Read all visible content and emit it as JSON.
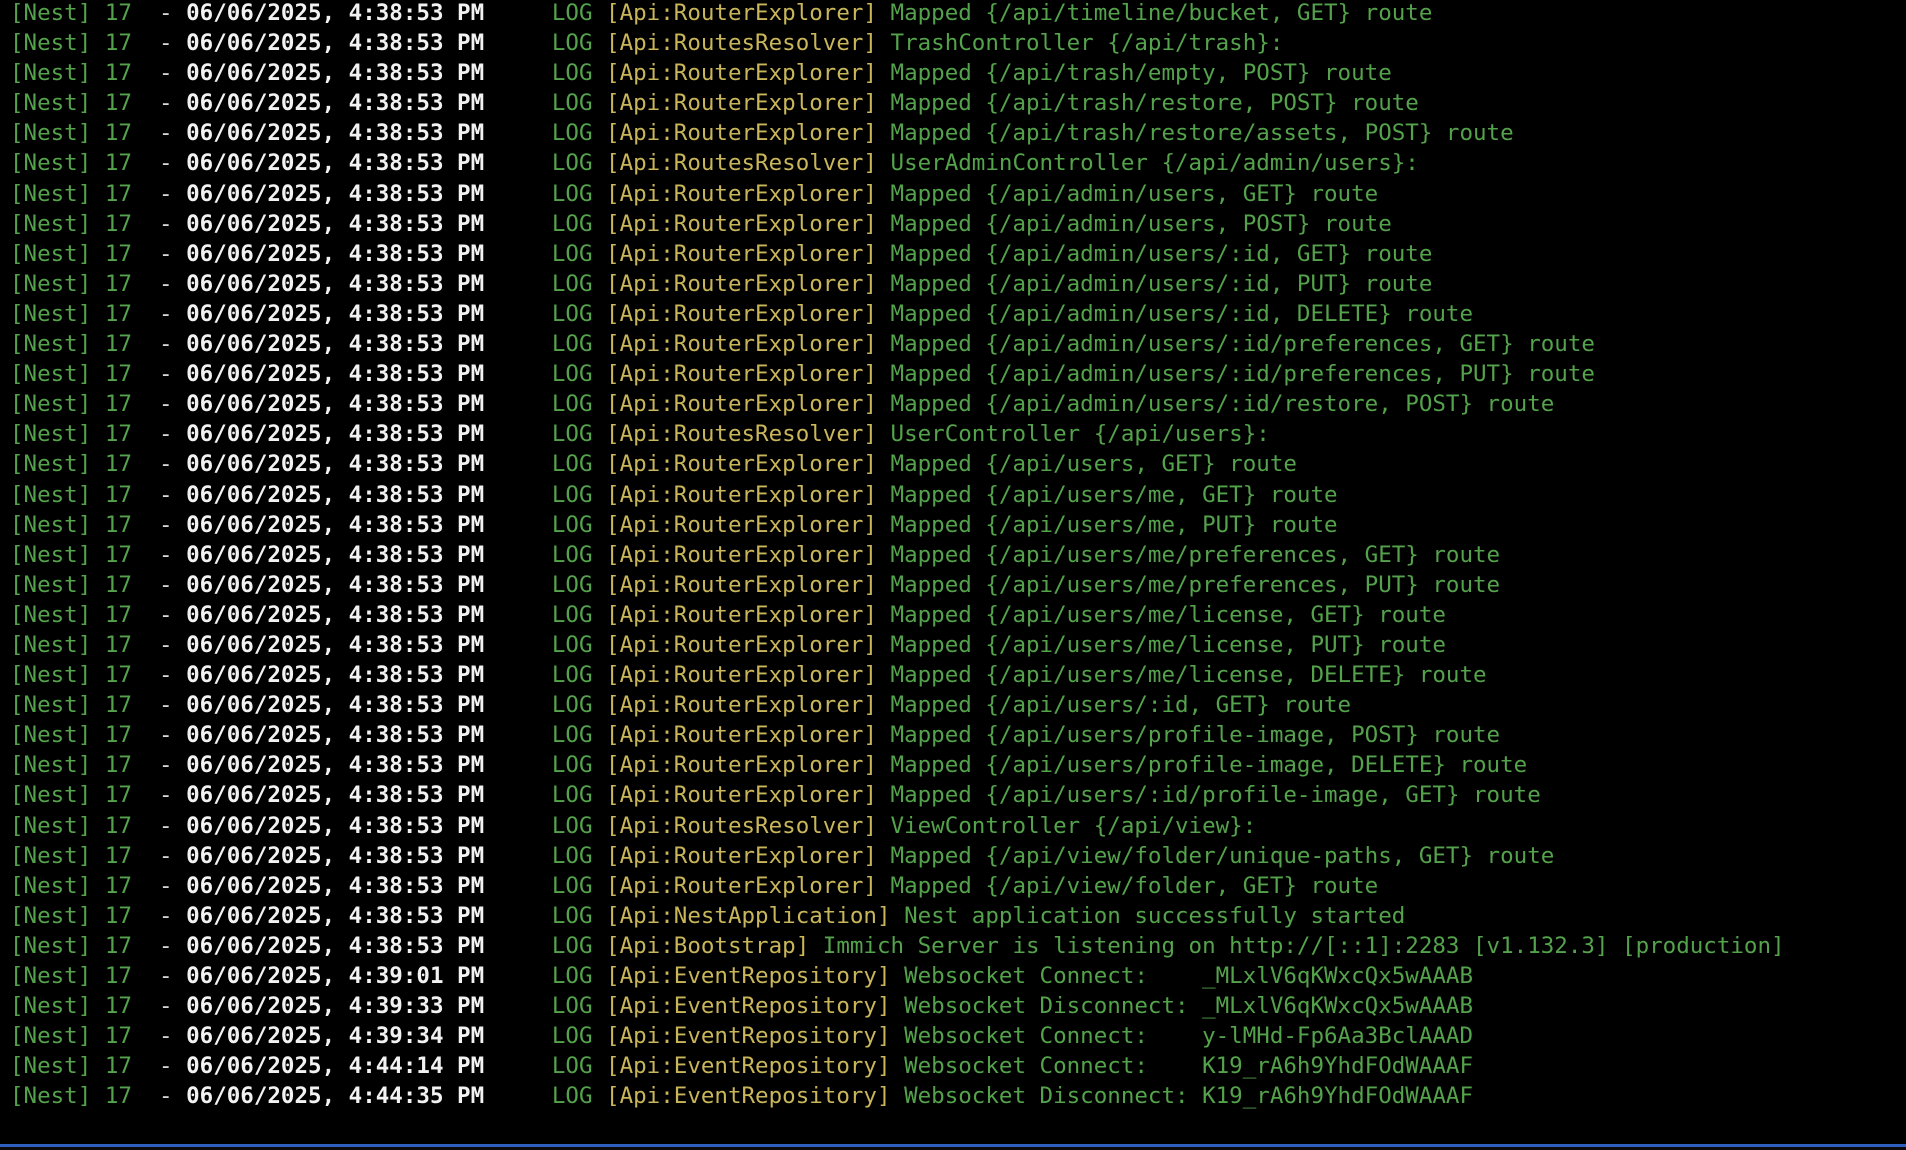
{
  "terminal": {
    "colors": {
      "background": "#000000",
      "prefix": "#54a24b",
      "timestamp": "#f2f2f2",
      "context": "#c9b65a",
      "message": "#54a24b",
      "border": "#2f5fbf"
    },
    "lines": [
      {
        "prefix": "[Nest] 17  ",
        "dash": "- ",
        "timestamp": "06/06/2025, 4:38:53 PM",
        "level": "     LOG ",
        "context": "[Api:RouterExplorer]",
        "message": " Mapped {/api/timeline/bucket, GET} route"
      },
      {
        "prefix": "[Nest] 17  ",
        "dash": "- ",
        "timestamp": "06/06/2025, 4:38:53 PM",
        "level": "     LOG ",
        "context": "[Api:RoutesResolver]",
        "message": " TrashController {/api/trash}:"
      },
      {
        "prefix": "[Nest] 17  ",
        "dash": "- ",
        "timestamp": "06/06/2025, 4:38:53 PM",
        "level": "     LOG ",
        "context": "[Api:RouterExplorer]",
        "message": " Mapped {/api/trash/empty, POST} route"
      },
      {
        "prefix": "[Nest] 17  ",
        "dash": "- ",
        "timestamp": "06/06/2025, 4:38:53 PM",
        "level": "     LOG ",
        "context": "[Api:RouterExplorer]",
        "message": " Mapped {/api/trash/restore, POST} route"
      },
      {
        "prefix": "[Nest] 17  ",
        "dash": "- ",
        "timestamp": "06/06/2025, 4:38:53 PM",
        "level": "     LOG ",
        "context": "[Api:RouterExplorer]",
        "message": " Mapped {/api/trash/restore/assets, POST} route"
      },
      {
        "prefix": "[Nest] 17  ",
        "dash": "- ",
        "timestamp": "06/06/2025, 4:38:53 PM",
        "level": "     LOG ",
        "context": "[Api:RoutesResolver]",
        "message": " UserAdminController {/api/admin/users}:"
      },
      {
        "prefix": "[Nest] 17  ",
        "dash": "- ",
        "timestamp": "06/06/2025, 4:38:53 PM",
        "level": "     LOG ",
        "context": "[Api:RouterExplorer]",
        "message": " Mapped {/api/admin/users, GET} route"
      },
      {
        "prefix": "[Nest] 17  ",
        "dash": "- ",
        "timestamp": "06/06/2025, 4:38:53 PM",
        "level": "     LOG ",
        "context": "[Api:RouterExplorer]",
        "message": " Mapped {/api/admin/users, POST} route"
      },
      {
        "prefix": "[Nest] 17  ",
        "dash": "- ",
        "timestamp": "06/06/2025, 4:38:53 PM",
        "level": "     LOG ",
        "context": "[Api:RouterExplorer]",
        "message": " Mapped {/api/admin/users/:id, GET} route"
      },
      {
        "prefix": "[Nest] 17  ",
        "dash": "- ",
        "timestamp": "06/06/2025, 4:38:53 PM",
        "level": "     LOG ",
        "context": "[Api:RouterExplorer]",
        "message": " Mapped {/api/admin/users/:id, PUT} route"
      },
      {
        "prefix": "[Nest] 17  ",
        "dash": "- ",
        "timestamp": "06/06/2025, 4:38:53 PM",
        "level": "     LOG ",
        "context": "[Api:RouterExplorer]",
        "message": " Mapped {/api/admin/users/:id, DELETE} route"
      },
      {
        "prefix": "[Nest] 17  ",
        "dash": "- ",
        "timestamp": "06/06/2025, 4:38:53 PM",
        "level": "     LOG ",
        "context": "[Api:RouterExplorer]",
        "message": " Mapped {/api/admin/users/:id/preferences, GET} route"
      },
      {
        "prefix": "[Nest] 17  ",
        "dash": "- ",
        "timestamp": "06/06/2025, 4:38:53 PM",
        "level": "     LOG ",
        "context": "[Api:RouterExplorer]",
        "message": " Mapped {/api/admin/users/:id/preferences, PUT} route"
      },
      {
        "prefix": "[Nest] 17  ",
        "dash": "- ",
        "timestamp": "06/06/2025, 4:38:53 PM",
        "level": "     LOG ",
        "context": "[Api:RouterExplorer]",
        "message": " Mapped {/api/admin/users/:id/restore, POST} route"
      },
      {
        "prefix": "[Nest] 17  ",
        "dash": "- ",
        "timestamp": "06/06/2025, 4:38:53 PM",
        "level": "     LOG ",
        "context": "[Api:RoutesResolver]",
        "message": " UserController {/api/users}:"
      },
      {
        "prefix": "[Nest] 17  ",
        "dash": "- ",
        "timestamp": "06/06/2025, 4:38:53 PM",
        "level": "     LOG ",
        "context": "[Api:RouterExplorer]",
        "message": " Mapped {/api/users, GET} route"
      },
      {
        "prefix": "[Nest] 17  ",
        "dash": "- ",
        "timestamp": "06/06/2025, 4:38:53 PM",
        "level": "     LOG ",
        "context": "[Api:RouterExplorer]",
        "message": " Mapped {/api/users/me, GET} route"
      },
      {
        "prefix": "[Nest] 17  ",
        "dash": "- ",
        "timestamp": "06/06/2025, 4:38:53 PM",
        "level": "     LOG ",
        "context": "[Api:RouterExplorer]",
        "message": " Mapped {/api/users/me, PUT} route"
      },
      {
        "prefix": "[Nest] 17  ",
        "dash": "- ",
        "timestamp": "06/06/2025, 4:38:53 PM",
        "level": "     LOG ",
        "context": "[Api:RouterExplorer]",
        "message": " Mapped {/api/users/me/preferences, GET} route"
      },
      {
        "prefix": "[Nest] 17  ",
        "dash": "- ",
        "timestamp": "06/06/2025, 4:38:53 PM",
        "level": "     LOG ",
        "context": "[Api:RouterExplorer]",
        "message": " Mapped {/api/users/me/preferences, PUT} route"
      },
      {
        "prefix": "[Nest] 17  ",
        "dash": "- ",
        "timestamp": "06/06/2025, 4:38:53 PM",
        "level": "     LOG ",
        "context": "[Api:RouterExplorer]",
        "message": " Mapped {/api/users/me/license, GET} route"
      },
      {
        "prefix": "[Nest] 17  ",
        "dash": "- ",
        "timestamp": "06/06/2025, 4:38:53 PM",
        "level": "     LOG ",
        "context": "[Api:RouterExplorer]",
        "message": " Mapped {/api/users/me/license, PUT} route"
      },
      {
        "prefix": "[Nest] 17  ",
        "dash": "- ",
        "timestamp": "06/06/2025, 4:38:53 PM",
        "level": "     LOG ",
        "context": "[Api:RouterExplorer]",
        "message": " Mapped {/api/users/me/license, DELETE} route"
      },
      {
        "prefix": "[Nest] 17  ",
        "dash": "- ",
        "timestamp": "06/06/2025, 4:38:53 PM",
        "level": "     LOG ",
        "context": "[Api:RouterExplorer]",
        "message": " Mapped {/api/users/:id, GET} route"
      },
      {
        "prefix": "[Nest] 17  ",
        "dash": "- ",
        "timestamp": "06/06/2025, 4:38:53 PM",
        "level": "     LOG ",
        "context": "[Api:RouterExplorer]",
        "message": " Mapped {/api/users/profile-image, POST} route"
      },
      {
        "prefix": "[Nest] 17  ",
        "dash": "- ",
        "timestamp": "06/06/2025, 4:38:53 PM",
        "level": "     LOG ",
        "context": "[Api:RouterExplorer]",
        "message": " Mapped {/api/users/profile-image, DELETE} route"
      },
      {
        "prefix": "[Nest] 17  ",
        "dash": "- ",
        "timestamp": "06/06/2025, 4:38:53 PM",
        "level": "     LOG ",
        "context": "[Api:RouterExplorer]",
        "message": " Mapped {/api/users/:id/profile-image, GET} route"
      },
      {
        "prefix": "[Nest] 17  ",
        "dash": "- ",
        "timestamp": "06/06/2025, 4:38:53 PM",
        "level": "     LOG ",
        "context": "[Api:RoutesResolver]",
        "message": " ViewController {/api/view}:"
      },
      {
        "prefix": "[Nest] 17  ",
        "dash": "- ",
        "timestamp": "06/06/2025, 4:38:53 PM",
        "level": "     LOG ",
        "context": "[Api:RouterExplorer]",
        "message": " Mapped {/api/view/folder/unique-paths, GET} route"
      },
      {
        "prefix": "[Nest] 17  ",
        "dash": "- ",
        "timestamp": "06/06/2025, 4:38:53 PM",
        "level": "     LOG ",
        "context": "[Api:RouterExplorer]",
        "message": " Mapped {/api/view/folder, GET} route"
      },
      {
        "prefix": "[Nest] 17  ",
        "dash": "- ",
        "timestamp": "06/06/2025, 4:38:53 PM",
        "level": "     LOG ",
        "context": "[Api:NestApplication]",
        "message": " Nest application successfully started"
      },
      {
        "prefix": "[Nest] 17  ",
        "dash": "- ",
        "timestamp": "06/06/2025, 4:38:53 PM",
        "level": "     LOG ",
        "context": "[Api:Bootstrap]",
        "message": " Immich Server is listening on http://[::1]:2283 [v1.132.3] [production]"
      },
      {
        "prefix": "[Nest] 17  ",
        "dash": "- ",
        "timestamp": "06/06/2025, 4:39:01 PM",
        "level": "     LOG ",
        "context": "[Api:EventRepository]",
        "message": " Websocket Connect:    _MLxlV6qKWxcQx5wAAAB"
      },
      {
        "prefix": "[Nest] 17  ",
        "dash": "- ",
        "timestamp": "06/06/2025, 4:39:33 PM",
        "level": "     LOG ",
        "context": "[Api:EventRepository]",
        "message": " Websocket Disconnect: _MLxlV6qKWxcQx5wAAAB"
      },
      {
        "prefix": "[Nest] 17  ",
        "dash": "- ",
        "timestamp": "06/06/2025, 4:39:34 PM",
        "level": "     LOG ",
        "context": "[Api:EventRepository]",
        "message": " Websocket Connect:    y-lMHd-Fp6Aa3BclAAAD"
      },
      {
        "prefix": "[Nest] 17  ",
        "dash": "- ",
        "timestamp": "06/06/2025, 4:44:14 PM",
        "level": "     LOG ",
        "context": "[Api:EventRepository]",
        "message": " Websocket Connect:    K19_rA6h9YhdFOdWAAAF"
      },
      {
        "prefix": "[Nest] 17  ",
        "dash": "- ",
        "timestamp": "06/06/2025, 4:44:35 PM",
        "level": "     LOG ",
        "context": "[Api:EventRepository]",
        "message": " Websocket Disconnect: K19_rA6h9YhdFOdWAAAF"
      }
    ]
  }
}
